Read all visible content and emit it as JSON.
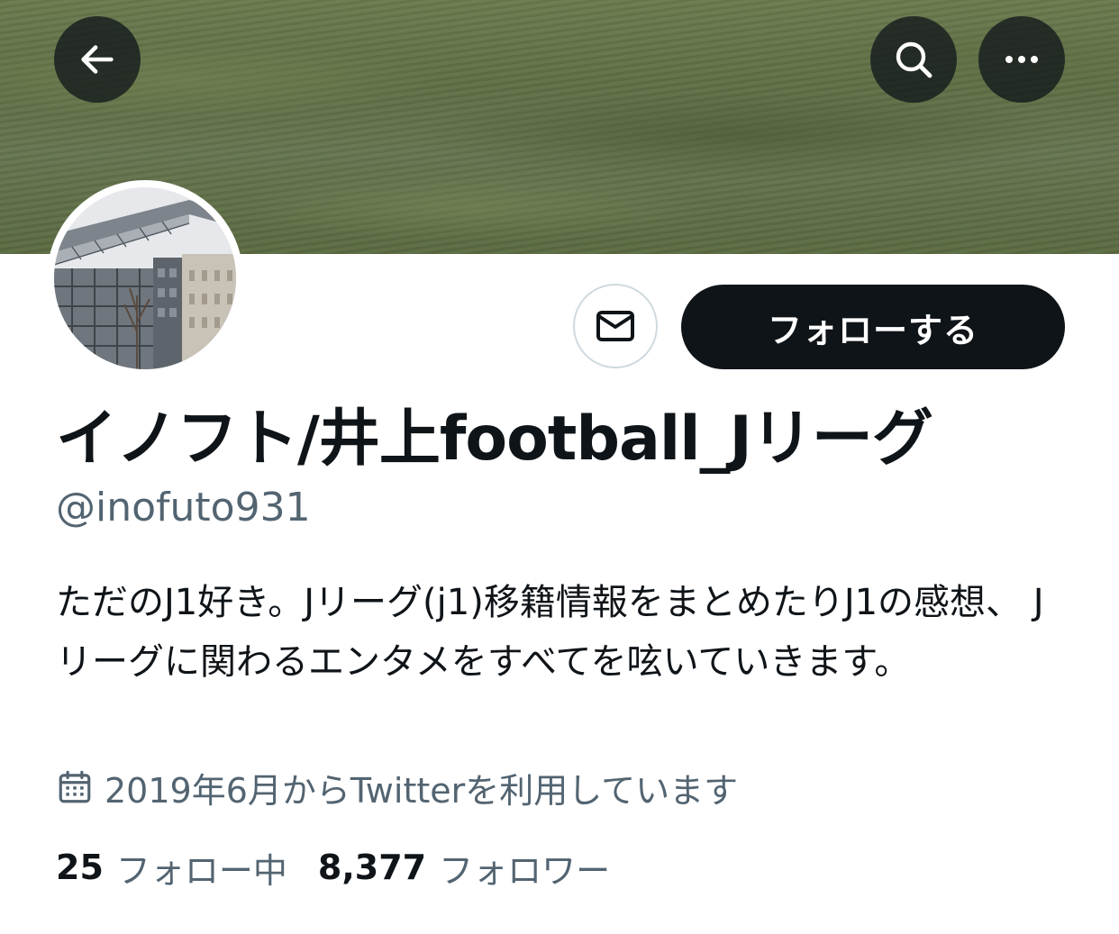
{
  "header": {
    "back_icon": "arrow-left-icon",
    "search_icon": "search-icon",
    "more_icon": "more-horizontal-icon"
  },
  "profile": {
    "display_name": "イノフト/井上football_Jリーグ",
    "handle": "@inofuto931",
    "bio": "ただのJ1好き。Jリーグ(j1)移籍情報をまとめたりJ1の感想、 Jリーグに関わるエンタメをすべてを呟いていきます。",
    "joined": "2019年6月からTwitterを利用しています",
    "joined_icon": "calendar-icon"
  },
  "actions": {
    "message_icon": "mail-icon",
    "follow_label": "フォローする"
  },
  "stats": {
    "following_count": "25",
    "following_label": "フォロー中",
    "followers_count": "8,377",
    "followers_label": "フォロワー"
  },
  "colors": {
    "primary_text": "#0f1419",
    "secondary_text": "#536471",
    "follow_button_bg": "#0f1419",
    "border": "#cfd9de"
  }
}
